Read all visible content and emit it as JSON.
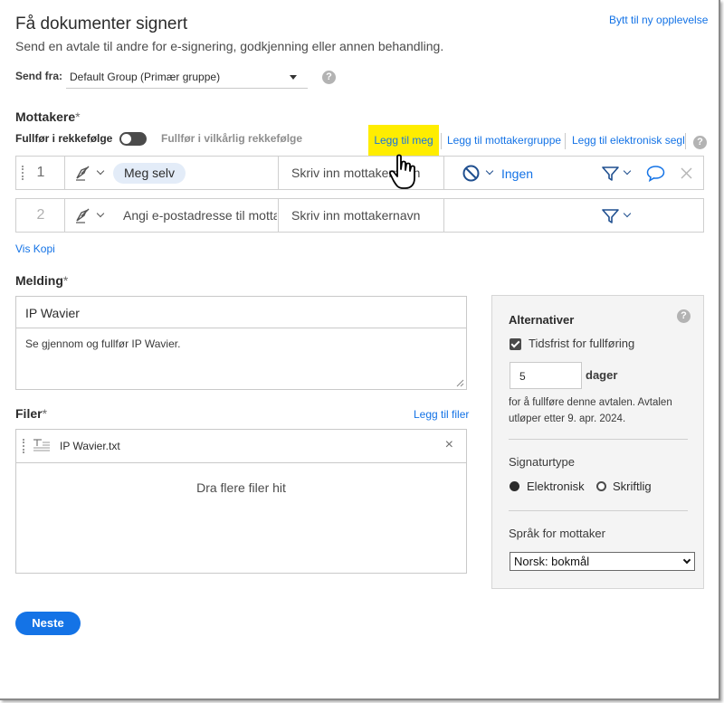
{
  "header": {
    "title": "Få dokumenter signert",
    "subtitle": "Send en avtale til andre for e-signering, godkjenning eller annen behandling.",
    "switch_experience": "Bytt til ny opplevelse"
  },
  "send_from": {
    "label": "Send fra:",
    "value": "Default Group (Primær gruppe)"
  },
  "recipients": {
    "label": "Mottakere",
    "required_mark": "*",
    "order_label": "Fullfør i rekkefølge",
    "order_toggle_on": false,
    "any_order_label": "Fullfør i vilkårlig rekkefølge",
    "add_me": "Legg til meg",
    "add_group": "Legg til mottakergruppe",
    "add_seal": "Legg til elektronisk segl",
    "rows": [
      {
        "number": "1",
        "chip": "Meg selv",
        "name_placeholder": "Skriv inn mottakernavn",
        "auth_label": "Ingen",
        "auth_icon": "blocked-icon"
      },
      {
        "number": "2",
        "email_placeholder": "Angi e-postadresse til mottaker",
        "name_placeholder": "Skriv inn mottakernavn"
      }
    ],
    "show_cc": "Vis Kopi"
  },
  "message": {
    "label": "Melding",
    "required_mark": "*",
    "title_value": "IP Wavier",
    "body_value": "Se gjennom og fullfør IP Wavier."
  },
  "files": {
    "label": "Filer",
    "required_mark": "*",
    "add_files": "Legg til filer",
    "items": [
      {
        "name": "IP Wavier.txt"
      }
    ],
    "drop_hint": "Dra flere filer hit"
  },
  "options": {
    "title": "Alternativer",
    "deadline_label": "Tidsfrist for fullføring",
    "deadline_checked": true,
    "days_value": "5",
    "days_label": "dager",
    "expire_text": "for å fullføre denne avtalen. Avtalen utløper etter 9. apr. 2024.",
    "signature_type_label": "Signaturtype",
    "signature_types": [
      "Elektronisk",
      "Skriftlig"
    ],
    "signature_selected": "Elektronisk",
    "language_label": "Språk for mottaker",
    "language_value": "Norsk: bokmål"
  },
  "footer": {
    "next": "Neste"
  },
  "colors": {
    "accent": "#1473e6",
    "highlight": "#ffed00",
    "chip_bg": "#e3ecf8"
  }
}
